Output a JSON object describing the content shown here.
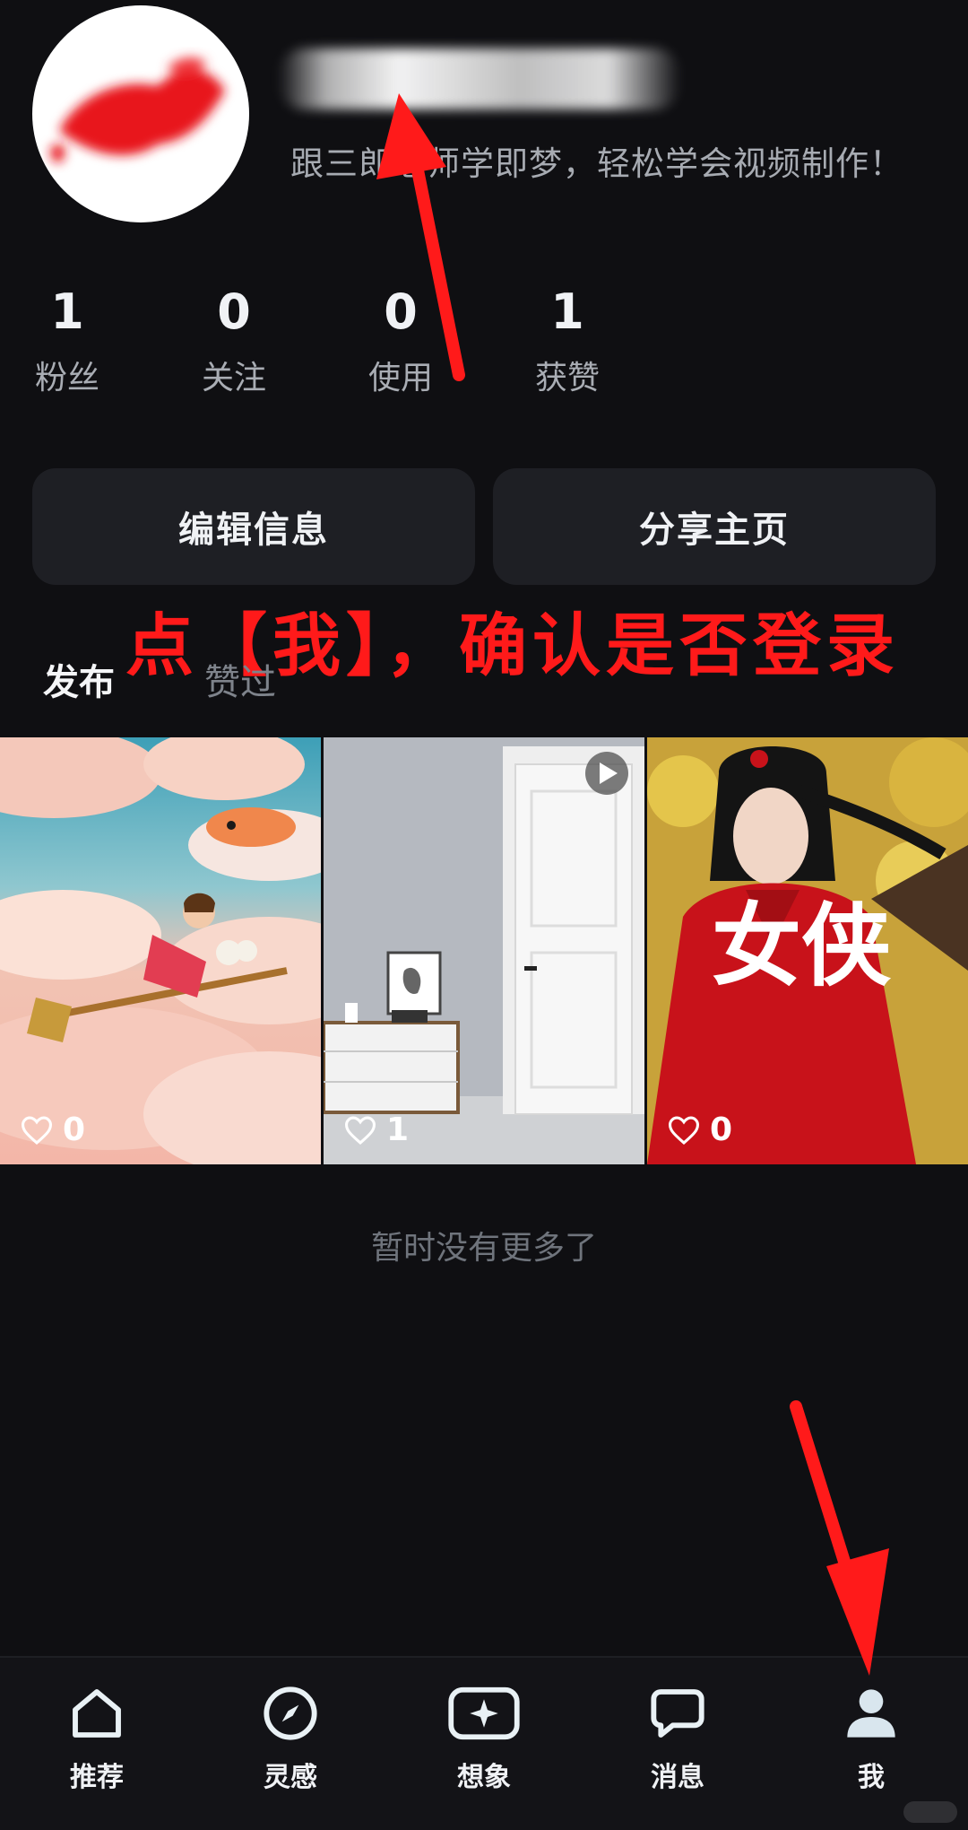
{
  "profile": {
    "bio": "跟三郎老师学即梦，轻松学会视频制作！"
  },
  "stats": [
    {
      "value": "1",
      "label": "粉丝"
    },
    {
      "value": "0",
      "label": "关注"
    },
    {
      "value": "0",
      "label": "使用"
    },
    {
      "value": "1",
      "label": "获赞"
    }
  ],
  "buttons": {
    "edit": "编辑信息",
    "share": "分享主页"
  },
  "annotation": "点【我】，确认是否登录",
  "tabs": {
    "posts": "发布",
    "liked": "赞过"
  },
  "grid": [
    {
      "likes": "0",
      "icon": "heart-icon"
    },
    {
      "likes": "1",
      "icon": "heart-icon",
      "badge": "play-icon"
    },
    {
      "likes": "0",
      "icon": "heart-icon",
      "overlay_text": "女侠"
    }
  ],
  "footer_text": "暂时没有更多了",
  "nav": [
    {
      "label": "推荐",
      "icon": "home-icon"
    },
    {
      "label": "灵感",
      "icon": "compass-icon"
    },
    {
      "label": "想象",
      "icon": "sparkle-icon"
    },
    {
      "label": "消息",
      "icon": "chat-icon"
    },
    {
      "label": "我",
      "icon": "person-icon"
    }
  ],
  "colors": {
    "background": "#0f0f12",
    "annotation": "#ff1a1a",
    "button_bg": "#1e1f24"
  }
}
